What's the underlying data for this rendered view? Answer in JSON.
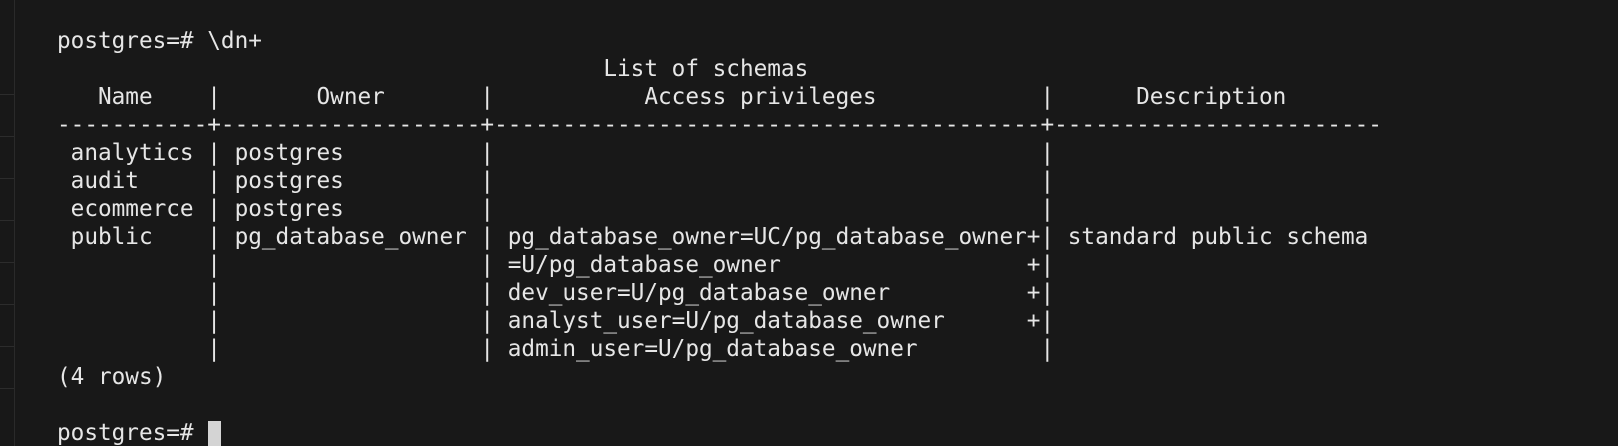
{
  "terminal": {
    "command_prompt": "postgres=# ",
    "command": "\\dn+",
    "table_title": "                                        List of schemas",
    "header_row": "   Name    |       Owner       |           Access privileges            |      Description       ",
    "separator_row": "-----------+-------------------+----------------------------------------+------------------------",
    "rows": [
      " analytics | postgres          |                                        | ",
      " audit     | postgres          |                                        | ",
      " ecommerce | postgres          |                                        | ",
      " public    | pg_database_owner | pg_database_owner=UC/pg_database_owner+| standard public schema",
      "           |                   | =U/pg_database_owner                  +| ",
      "           |                   | dev_user=U/pg_database_owner          +| ",
      "           |                   | analyst_user=U/pg_database_owner      +| ",
      "           |                   | admin_user=U/pg_database_owner         | "
    ],
    "row_count": "(4 rows)",
    "blank_line": "",
    "final_prompt": "postgres=# "
  }
}
